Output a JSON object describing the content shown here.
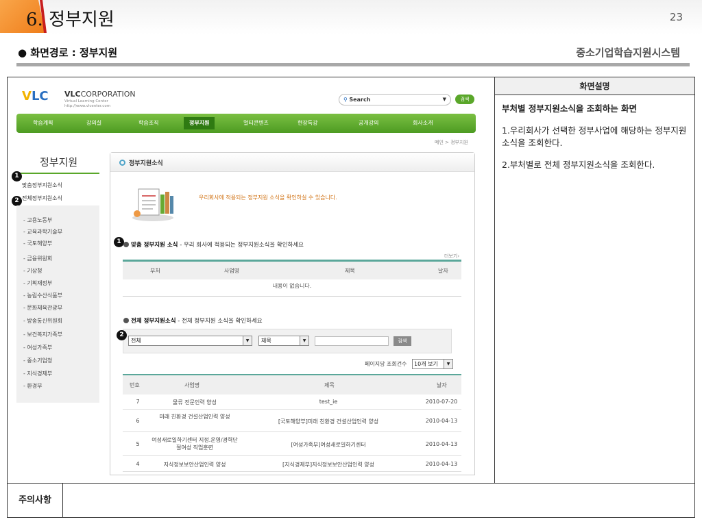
{
  "slide": {
    "number_prefix": "6.",
    "title": "정부지원",
    "page_number": "23",
    "path": "● 화면경로 : 정부지원",
    "system_name": "중소기업학습지원시스템"
  },
  "description": {
    "header": "화면설명",
    "lines": [
      "부처별 정부지원소식을 조회하는 화면",
      "1.우리회사가 선택한 정부사업에 해당하는 정부지원소식을 조회한다.",
      "2.부처별로 전체 정부지원소식을 조회한다."
    ],
    "note_label": "주의사항"
  },
  "site": {
    "logo": {
      "v": "V",
      "l": "L",
      "c": "C"
    },
    "corp_bold": "VLC",
    "corp_rest": "CORPORATION",
    "corp_sub1": "Virtual Learning Center",
    "corp_sub2": "http://www.vlcenter.com",
    "search_placeholder": "Search",
    "search_button": "검색",
    "nav": [
      "학습계획",
      "강의실",
      "학습조직",
      "정부지원",
      "멀티콘텐츠",
      "현장특강",
      "공개강의",
      "회사소개"
    ],
    "nav_active": "정부지원",
    "breadcrumb": "메인 > 정부지원",
    "sidebar": {
      "title": "정부지원",
      "items": [
        "맞춤정부지원소식",
        "전체정부지원소식"
      ],
      "sub_items": [
        "- 고용노동부",
        "- 교육과학기술부",
        "- 국토해양부",
        "- 금융위원회",
        "- 기상청",
        "- 기획재정부",
        "- 농림수산식품부",
        "- 문화체육관광부",
        "- 방송통신위원회",
        "- 보건복지가족부",
        "- 여성가족부",
        "- 중소기업청",
        "- 지식경제부",
        "- 환경부"
      ]
    },
    "panel_title": "정부지원소식",
    "intro_text": "우리회사에 적용되는 정부지원 소식을 확인하실 수 있습니다.",
    "section1": {
      "title": "맞춤 정부지원 소식",
      "desc": "- 우리 회사에 적용되는 정부지원소식을 확인하세요",
      "more": "더보기›",
      "columns": [
        "부처",
        "사업명",
        "제목",
        "날자"
      ],
      "empty": "내용이 없습니다."
    },
    "section2": {
      "title": "전체 정부지원소식",
      "desc": "- 전체 정부지원 소식을 확인하세요",
      "filter_select1": "전체",
      "filter_select2": "제목",
      "filter_button": "검색",
      "per_page_label": "페이지당 조회건수",
      "per_page_value": "10개 보기",
      "columns": [
        "번호",
        "사업명",
        "제목",
        "날자"
      ],
      "rows": [
        {
          "no": "7",
          "project": "물류 전문인력 양성",
          "title": "test_ie",
          "date": "2010-07-20"
        },
        {
          "no": "6",
          "project": "미래 친환경 건설산업인력 양성",
          "title": "[국토해양부]미래 친환경 건설산업인력 양성",
          "date": "2010-04-13"
        },
        {
          "no": "5",
          "project": "여성새로일하기센터 지정.운영/경력단절여성 직업훈련",
          "title": "[여성가족부]여성새로일하기센터",
          "date": "2010-04-13"
        },
        {
          "no": "4",
          "project": "지식정보보안산업인력 양성",
          "title": "[지식경제부]지식정보보안산업인력 양성",
          "date": "2010-04-13"
        }
      ]
    },
    "badges": [
      "1",
      "2"
    ]
  }
}
